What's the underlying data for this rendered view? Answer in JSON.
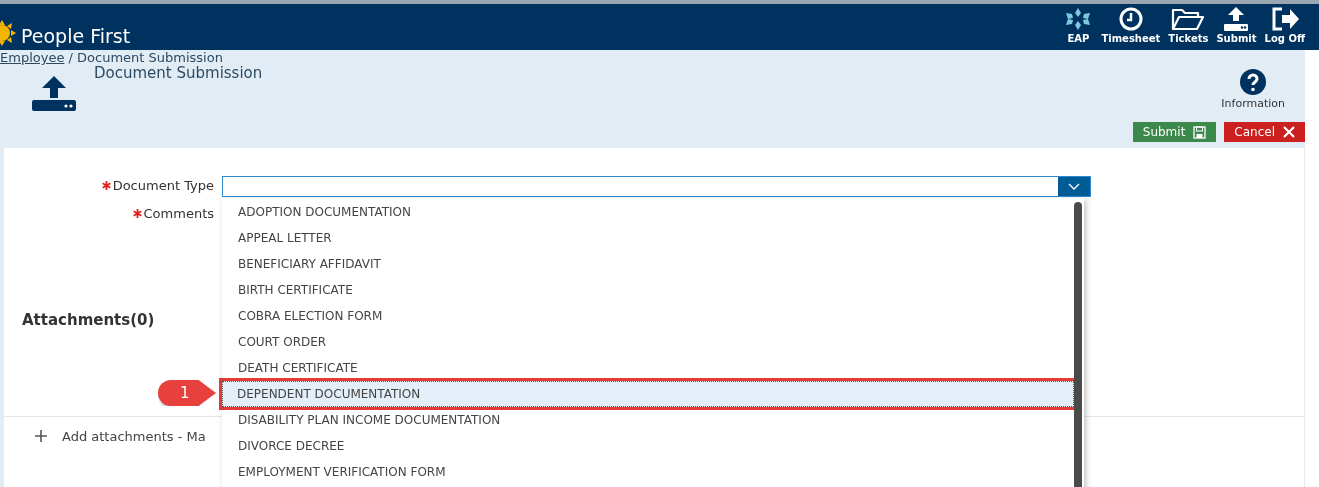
{
  "header": {
    "title": "People First",
    "nav": [
      {
        "kind": "eap",
        "label": "EAP"
      },
      {
        "kind": "clock",
        "label": "Timesheet"
      },
      {
        "kind": "folder",
        "label": "Tickets"
      },
      {
        "kind": "upload",
        "label": "Submit"
      },
      {
        "kind": "logoff",
        "label": "Log Off"
      }
    ]
  },
  "breadcrumb": {
    "link": "Employee",
    "current": "/ Document Submission"
  },
  "page_title": "Document Submission",
  "info_label": "Information",
  "actions": [
    {
      "kind": "submit",
      "label": "Submit"
    },
    {
      "kind": "cancel",
      "label": "Cancel"
    }
  ],
  "fields": [
    {
      "label": "Document Type",
      "required": true
    },
    {
      "label": "Comments",
      "required": true
    }
  ],
  "attachments_heading": "Attachments(0)",
  "add_attachments": "Add attachments - Ma",
  "dropdown": {
    "expanded": true,
    "options": [
      {
        "label": "ADOPTION DOCUMENTATION",
        "selected": false
      },
      {
        "label": "APPEAL LETTER",
        "selected": false
      },
      {
        "label": "BENEFICIARY AFFIDAVIT",
        "selected": false
      },
      {
        "label": "BIRTH CERTIFICATE",
        "selected": false
      },
      {
        "label": "COBRA ELECTION FORM",
        "selected": false
      },
      {
        "label": "COURT ORDER",
        "selected": false
      },
      {
        "label": "DEATH CERTIFICATE",
        "selected": false
      },
      {
        "label": "DEPENDENT DOCUMENTATION",
        "selected": true
      },
      {
        "label": "DISABILITY PLAN INCOME DOCUMENTATION",
        "selected": false
      },
      {
        "label": "DIVORCE DECREE",
        "selected": false
      },
      {
        "label": "EMPLOYMENT VERIFICATION FORM",
        "selected": false
      }
    ]
  },
  "callout": {
    "label": "1"
  }
}
